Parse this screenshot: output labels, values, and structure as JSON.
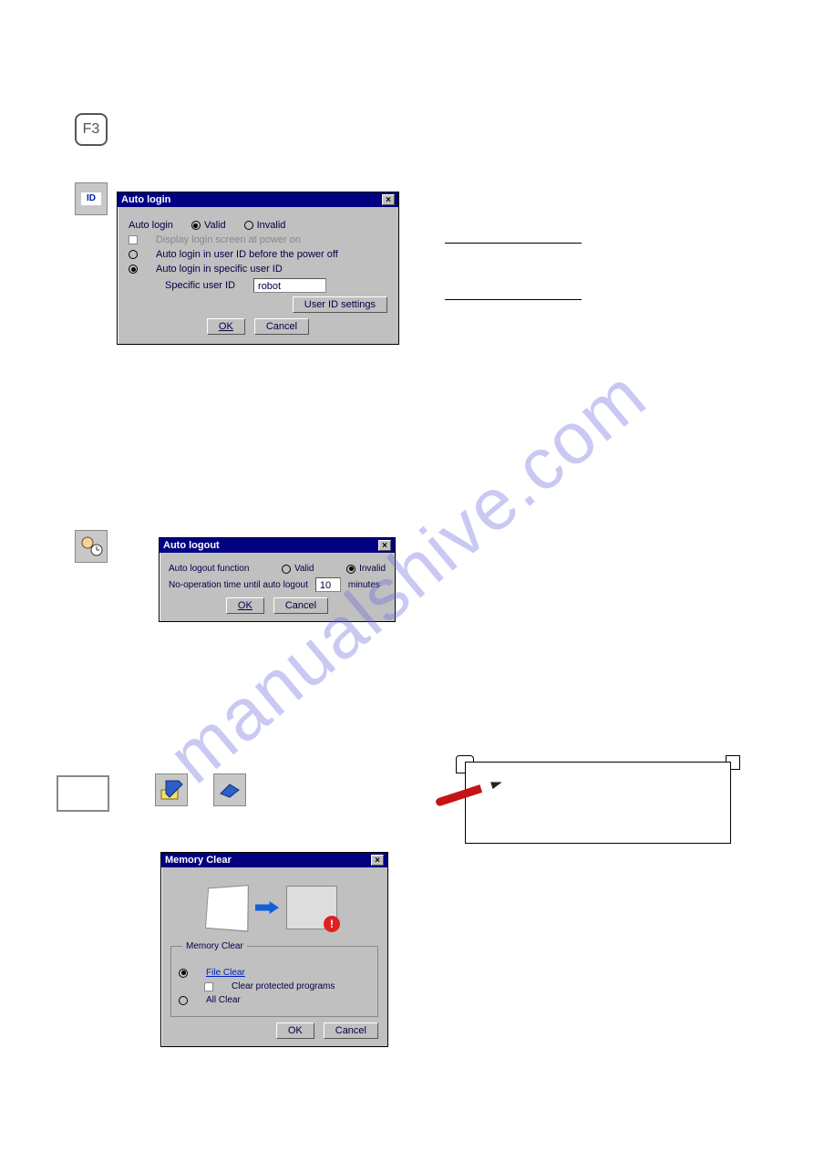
{
  "watermark": "manualshive.com",
  "f3_label": "F3",
  "id_icon_label": "ID",
  "dlg_autologin": {
    "title": "Auto login",
    "auto_login_label": "Auto login",
    "valid": "Valid",
    "invalid": "Invalid",
    "display_at_poweron": "Display login screen at power on",
    "before_poweroff": "Auto login in user ID before the power off",
    "specific_user": "Auto login in specific user ID",
    "specific_user_id_label": "Specific user ID",
    "specific_user_id_value": "robot",
    "user_id_settings": "User ID settings",
    "ok": "OK",
    "cancel": "Cancel"
  },
  "dlg_autologout": {
    "title": "Auto logout",
    "fn_label": "Auto logout function",
    "valid": "Valid",
    "invalid": "Invalid",
    "noop_label": "No-operation time until auto logout",
    "noop_value": "10",
    "minutes": "minutes",
    "ok": "OK",
    "cancel": "Cancel"
  },
  "dlg_memclear": {
    "title": "Memory Clear",
    "group": "Memory Clear",
    "file_clear": "File Clear",
    "clear_protected": "Clear protected programs",
    "all_clear": "All Clear",
    "ok": "OK",
    "cancel": "Cancel"
  },
  "icons": {
    "clock": "clock-user-icon",
    "tool1": "edit-config-icon",
    "tool2": "eraser-icon",
    "blank": "blank-panel-icon"
  }
}
